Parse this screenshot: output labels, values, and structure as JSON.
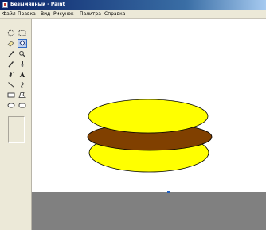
{
  "window": {
    "title": "Безымянный - Paint"
  },
  "menu": {
    "items": [
      {
        "label": "Файл"
      },
      {
        "label": "Правка"
      },
      {
        "label": "Вид"
      },
      {
        "label": "Рисунок"
      },
      {
        "label": "Палитра"
      },
      {
        "label": "Справка"
      }
    ]
  },
  "toolbox": {
    "tools": [
      {
        "icon": "free-select-icon"
      },
      {
        "icon": "rect-select-icon"
      },
      {
        "icon": "eraser-icon"
      },
      {
        "icon": "fill-icon",
        "selected": true
      },
      {
        "icon": "color-picker-icon"
      },
      {
        "icon": "magnifier-icon"
      },
      {
        "icon": "pencil-icon"
      },
      {
        "icon": "brush-icon"
      },
      {
        "icon": "airbrush-icon"
      },
      {
        "icon": "text-icon",
        "glyph": "A"
      },
      {
        "icon": "line-icon"
      },
      {
        "icon": "curve-icon"
      },
      {
        "icon": "rectangle-icon"
      },
      {
        "icon": "polygon-icon"
      },
      {
        "icon": "ellipse-icon"
      },
      {
        "icon": "rounded-rectangle-icon"
      }
    ]
  },
  "colors": {
    "canvas": "#ffffff",
    "workspace": "#808080",
    "ellipse_yellow": "#ffff00",
    "ellipse_brown": "#804000",
    "outline": "#000000",
    "titlebar": "#0a246a",
    "selection": "#316ac5"
  }
}
